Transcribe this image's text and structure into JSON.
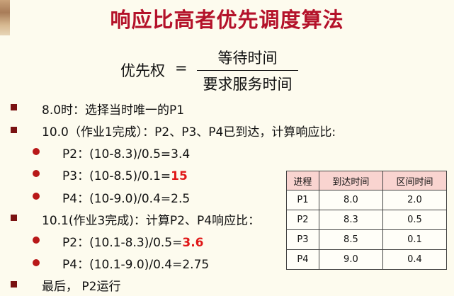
{
  "title": "响应比高者优先调度算法",
  "formula": {
    "lhs": "优先权",
    "equals": "=",
    "numerator": "等待时间",
    "denominator": "要求服务时间"
  },
  "lines": [
    {
      "text": "8.0时：选择当时唯一的P1"
    },
    {
      "text": "10.0（作业1完成）：P2、P3、P4已到达，计算响应比:"
    },
    {
      "text": "P2：(10-8.3)/0.5=3.4"
    },
    {
      "prefix": "P3：(10-8.5)/0.1=",
      "highlight": "15"
    },
    {
      "text": "P4：(10-9.0)/0.4=2.5"
    },
    {
      "text": "10.1(作业3完成)：计算P2、P4响应比："
    },
    {
      "prefix": "P2：(10.1-8.3)/0.5=",
      "highlight": "3.6"
    },
    {
      "text": "P4：(10.1-9.0)/0.4=2.75"
    },
    {
      "text": "最后， P2运行"
    }
  ],
  "table": {
    "headers": [
      "进程",
      "到达时间",
      "区间时间"
    ],
    "rows": [
      [
        "P1",
        "8.0",
        "2.0"
      ],
      [
        "P2",
        "8.3",
        "0.5"
      ],
      [
        "P3",
        "8.5",
        "0.1"
      ],
      [
        "P4",
        "9.0",
        "0.4"
      ]
    ]
  },
  "colors": {
    "title": "#b4122a",
    "highlight": "#e01818",
    "header_fill": "#f9d4d0",
    "background": "#fdfbee"
  }
}
